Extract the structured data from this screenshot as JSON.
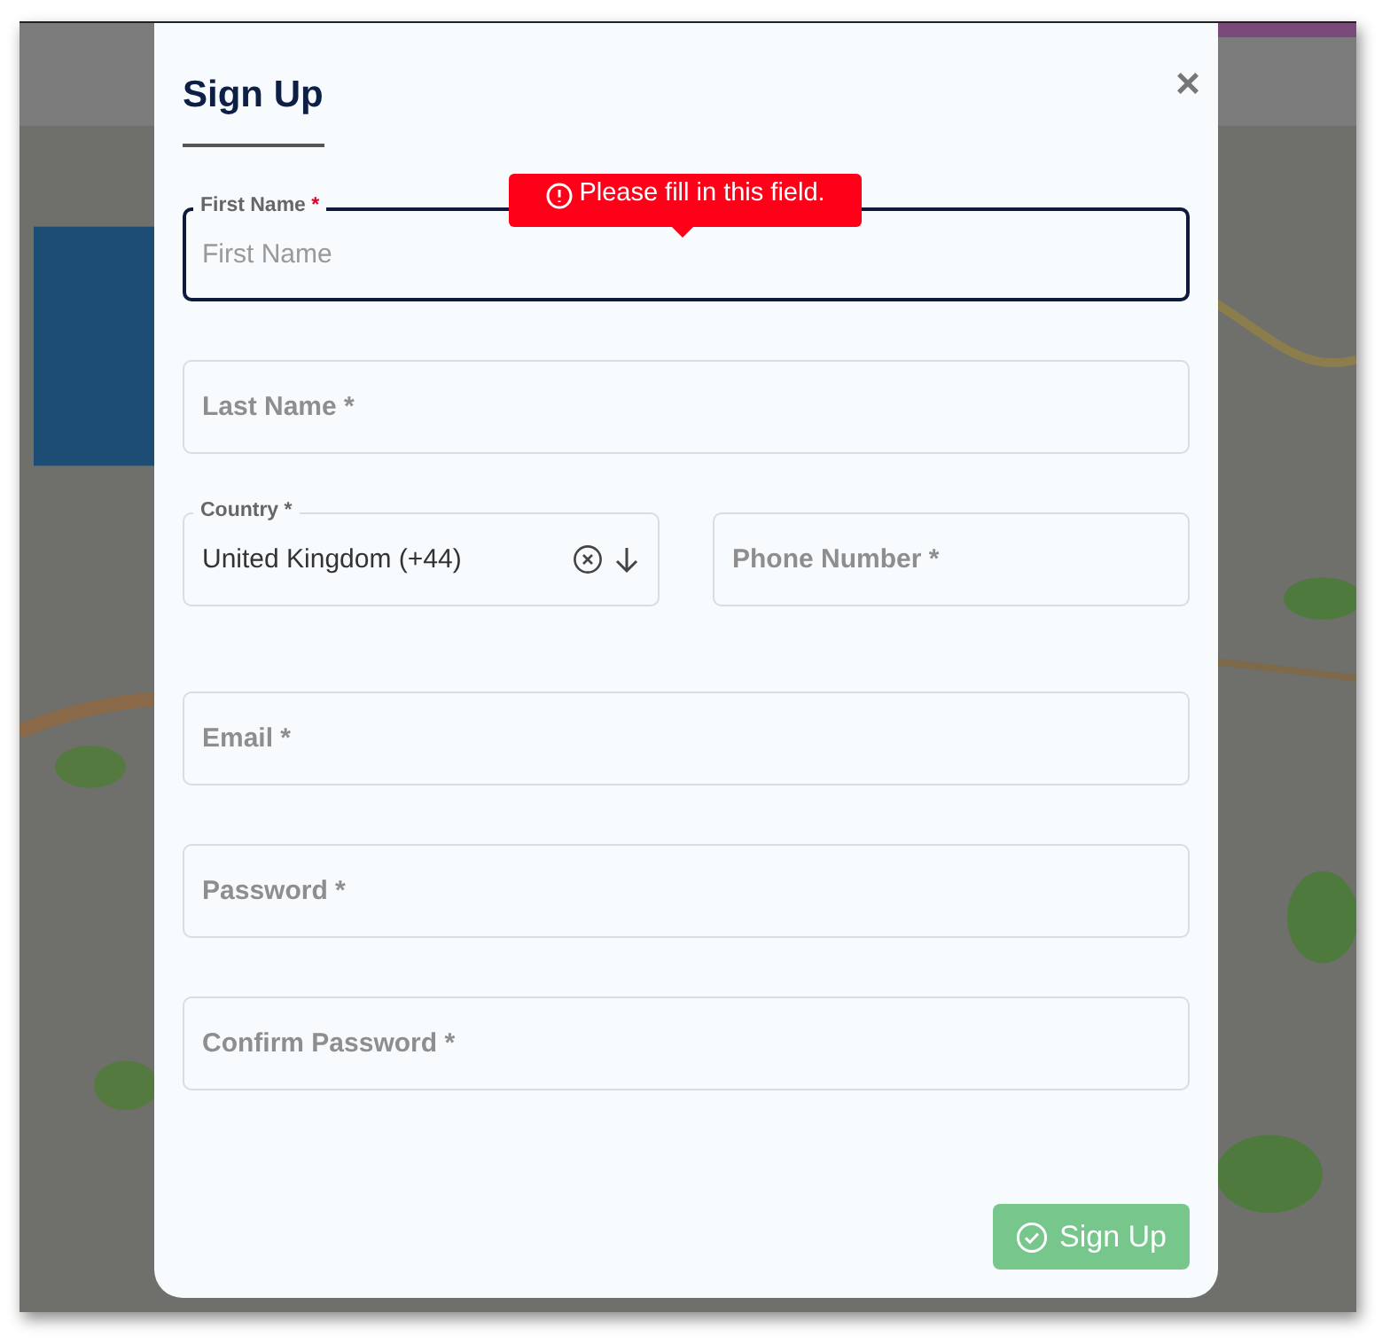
{
  "dialog": {
    "title": "Sign Up",
    "close": "×",
    "fields": [
      {
        "kind": "text",
        "label": "First Name",
        "required_mark": "*",
        "placeholder": "First Name",
        "focused": true,
        "error": "Please fill in this field."
      },
      {
        "kind": "text",
        "placeholder": "Last Name *",
        "focused": false
      },
      {
        "kind": "pair",
        "items": [
          {
            "kind": "select",
            "label": "Country *",
            "value": "United Kingdom (+44)",
            "focused": false
          },
          {
            "kind": "text",
            "placeholder": "Phone Number *",
            "focused": false
          }
        ]
      },
      {
        "kind": "text",
        "placeholder": "Email *",
        "focused": false
      },
      {
        "kind": "text",
        "placeholder": "Password *",
        "focused": false
      },
      {
        "kind": "text",
        "placeholder": "Confirm Password *",
        "focused": false
      }
    ],
    "submit": {
      "label": "Sign Up",
      "disabled": true
    }
  }
}
